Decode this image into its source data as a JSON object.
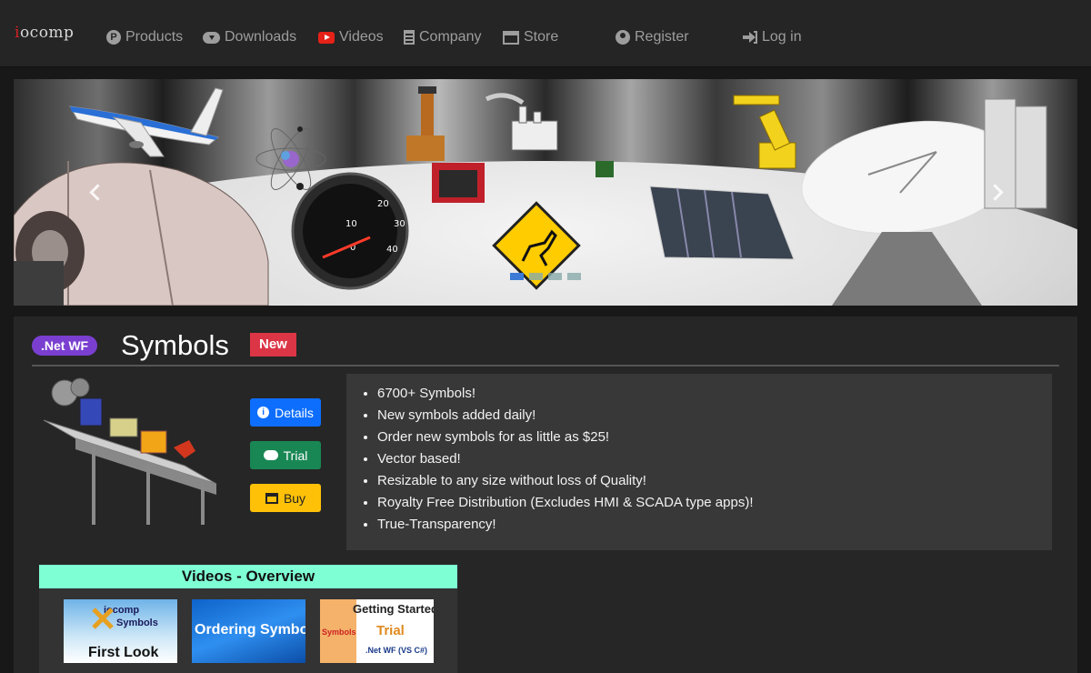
{
  "brand": {
    "logo_text": "iocomp"
  },
  "nav": {
    "products": "Products",
    "downloads": "Downloads",
    "videos": "Videos",
    "company": "Company",
    "store": "Store",
    "register": "Register",
    "login": "Log in"
  },
  "carousel": {
    "slides": 4,
    "active_slide": 1
  },
  "product": {
    "platform_badge": ".Net WF",
    "title": "Symbols",
    "new_badge": "New",
    "buttons": {
      "details": "Details",
      "trial": "Trial",
      "buy": "Buy"
    },
    "features": [
      "6700+ Symbols!",
      "New symbols added daily!",
      "Order new symbols for as little as $25!",
      "Vector based!",
      "Resizable to any size without loss of Quality!",
      "Royalty Free Distribution (Excludes HMI & SCADA type apps)!",
      "True-Transparency!"
    ]
  },
  "videos": {
    "heading": "Videos - Overview",
    "thumbs": [
      {
        "line1": "iocomp",
        "line2": "Symbols",
        "line3": "First Look"
      },
      {
        "line1": "Ordering Symbols"
      },
      {
        "line1": "Getting Started",
        "line2": "Symbols",
        "line3": "Trial",
        "line4": ".Net WF (VS C#)"
      }
    ]
  },
  "colors": {
    "navbar": "#252525",
    "badge_net": "#7a3fd0",
    "badge_new": "#dc3545",
    "details": "#0d6efd",
    "trial": "#198754",
    "buy": "#ffc107",
    "videos_header": "#7fffd4"
  }
}
